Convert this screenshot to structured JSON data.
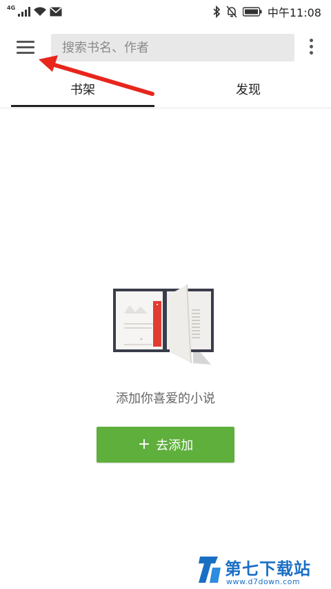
{
  "status_bar": {
    "network_type": "4G",
    "time": "中午11:08"
  },
  "toolbar": {
    "search_placeholder": "搜索书名、作者"
  },
  "tabs": [
    {
      "label": "书架",
      "selected": true
    },
    {
      "label": "发现",
      "selected": false
    }
  ],
  "empty_state": {
    "message": "添加你喜爱的小说",
    "add_button_label": "去添加"
  },
  "watermark": {
    "title": "第七下载站",
    "url": "www.d7down.com"
  },
  "colors": {
    "accent_green": "#5faf3c",
    "annotation_red": "#e8261c",
    "watermark_blue": "#1a6fc4",
    "bookmark_red": "#e03c31"
  }
}
